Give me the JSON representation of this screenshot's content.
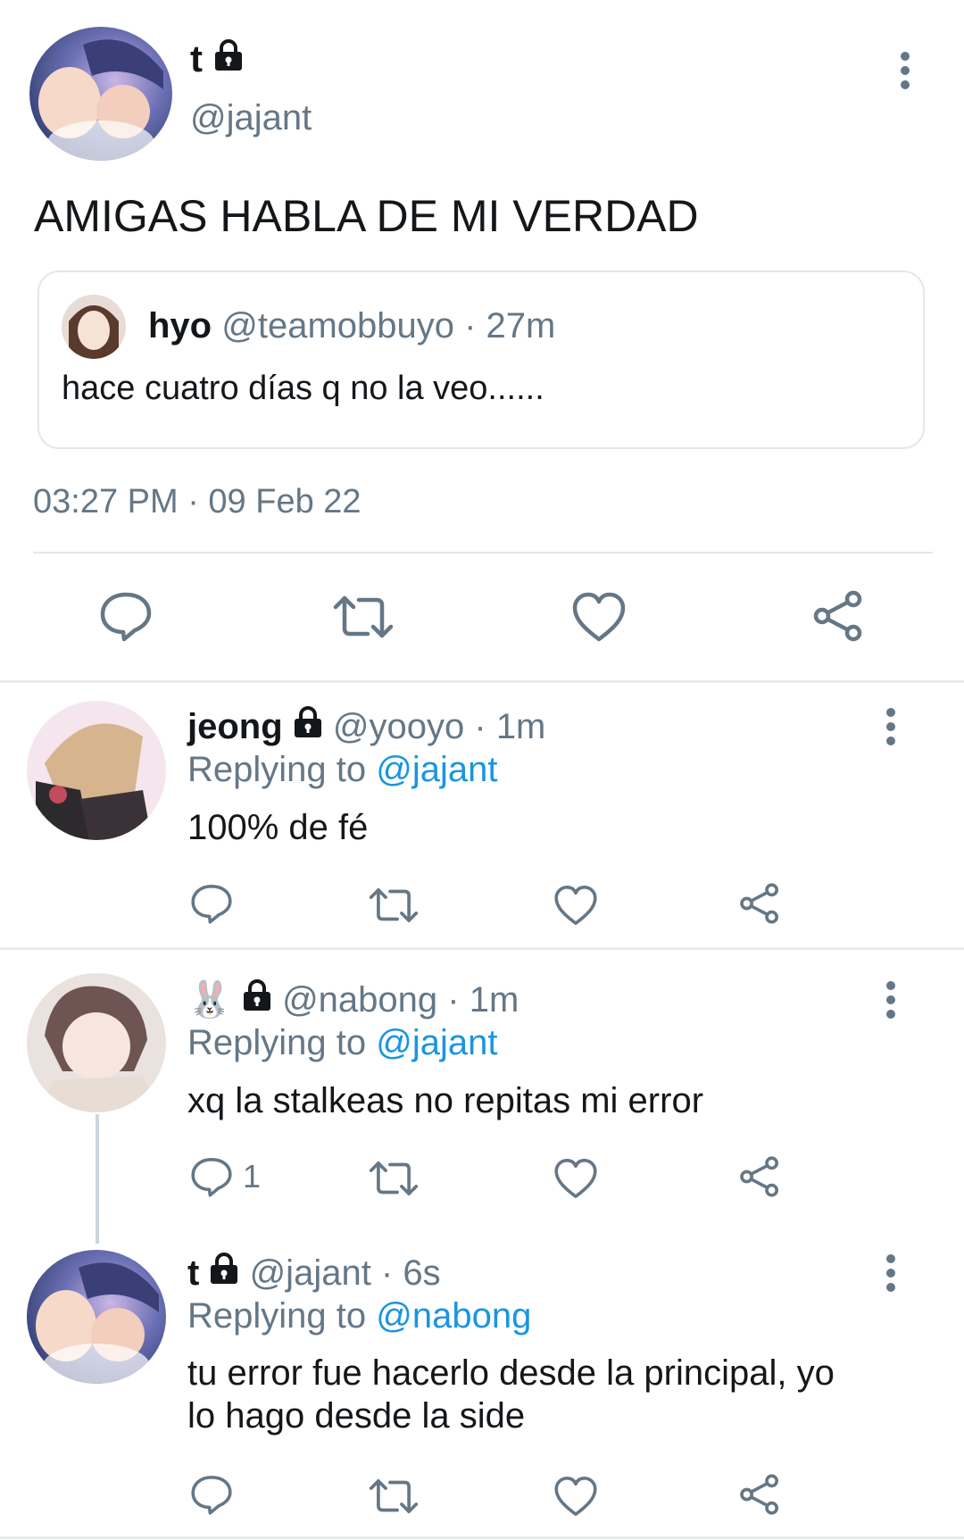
{
  "main_tweet": {
    "display_name": "t",
    "handle": "@jajant",
    "text": "AMIGAS HABLA DE MI VERDAD",
    "timestamp": "03:27 PM · 09 Feb 22",
    "quoted": {
      "display_name": "hyo",
      "handle_time": "@teamobbuyo · 27m",
      "text": "hace cuatro días q no la veo......"
    }
  },
  "replies": [
    {
      "display_name": "jeong",
      "handle_time": "@yooyo · 1m",
      "replying_prefix": "Replying to",
      "replying_to": "@jajant",
      "text": "100% de fé",
      "reply_count": ""
    },
    {
      "display_name": "🐰",
      "handle_time": "@nabong · 1m",
      "replying_prefix": "Replying to",
      "replying_to": "@jajant",
      "text": "xq la stalkeas no repitas mi error",
      "reply_count": "1"
    },
    {
      "display_name": "t",
      "handle_time": "@jajant · 6s",
      "replying_prefix": "Replying to",
      "replying_to": "@nabong",
      "text_line1": "tu error fue hacerlo desde la principal, yo",
      "text_line2": "lo hago desde la side",
      "reply_count": ""
    }
  ],
  "icons": [
    "lock-icon",
    "more-icon",
    "reply-icon",
    "retweet-icon",
    "like-icon",
    "share-icon"
  ],
  "colors": {
    "accent": "#1b95e0",
    "muted": "#657786",
    "divider": "#e6ecf0"
  }
}
